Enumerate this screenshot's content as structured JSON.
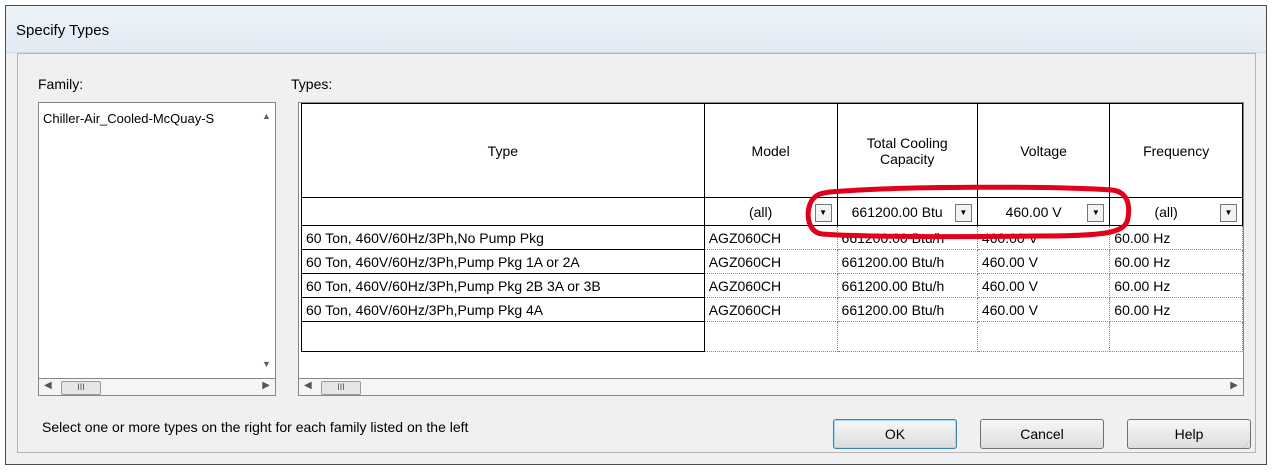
{
  "window": {
    "title": "Specify Types"
  },
  "family": {
    "label": "Family:",
    "items": [
      "Chiller-Air_Cooled-McQuay-S"
    ]
  },
  "types": {
    "label": "Types:",
    "columns": [
      "Type",
      "Model",
      "Total Cooling Capacity",
      "Voltage",
      "Frequency"
    ],
    "filters": [
      "",
      "(all)",
      "661200.00 Btu",
      "460.00 V",
      "(all)"
    ],
    "rows": [
      [
        "60 Ton, 460V/60Hz/3Ph,No Pump Pkg",
        "AGZ060CH",
        "661200.00 Btu/h",
        "460.00 V",
        "60.00 Hz"
      ],
      [
        "60 Ton, 460V/60Hz/3Ph,Pump Pkg 1A or 2A",
        "AGZ060CH",
        "661200.00 Btu/h",
        "460.00 V",
        "60.00 Hz"
      ],
      [
        "60 Ton, 460V/60Hz/3Ph,Pump Pkg 2B 3A or 3B",
        "AGZ060CH",
        "661200.00 Btu/h",
        "460.00 V",
        "60.00 Hz"
      ],
      [
        "60 Ton, 460V/60Hz/3Ph,Pump Pkg 4A",
        "AGZ060CH",
        "661200.00 Btu/h",
        "460.00 V",
        "60.00 Hz"
      ]
    ]
  },
  "status_text": "Select one or more types on the right for each family listed on the left",
  "buttons": {
    "ok": "OK",
    "cancel": "Cancel",
    "help": "Help"
  },
  "colors": {
    "annotation": "#e0001b"
  }
}
